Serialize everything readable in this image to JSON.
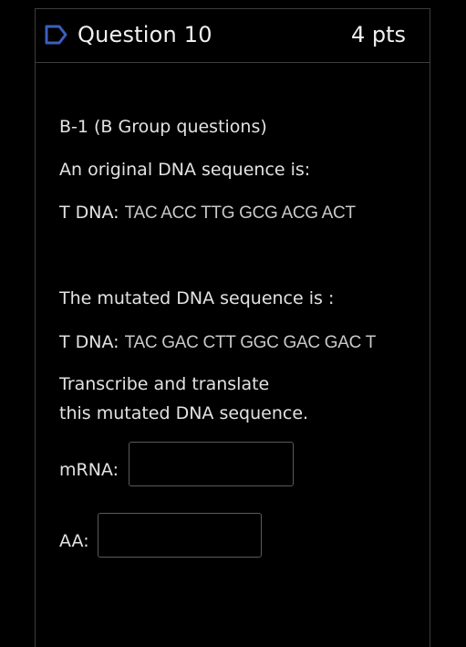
{
  "question": {
    "title": "Question 10",
    "points": "4 pts"
  },
  "body": {
    "group_heading": "B-1 (B Group questions)",
    "original_intro": "An original DNA sequence is:",
    "original_label": "T DNA:",
    "original_sequence": "TAC ACC TTG GCG ACG ACT",
    "mutated_intro": "The mutated DNA sequence is :",
    "mutated_label": "T DNA:",
    "mutated_sequence": "TAC GAC CTT GGC GAC GAC T",
    "instruction_line1": "Transcribe and translate",
    "instruction_line2": "this mutated DNA sequence."
  },
  "answers": {
    "mrna_label": "mRNA:",
    "mrna_value": "",
    "aa_label": "AA:",
    "aa_value": ""
  },
  "icons": {
    "flag": "bookmark-flag-icon"
  },
  "colors": {
    "background": "#000000",
    "text": "#e6e6e6",
    "flag_accent": "#3b5fc0",
    "border": "#3d3d3d"
  }
}
